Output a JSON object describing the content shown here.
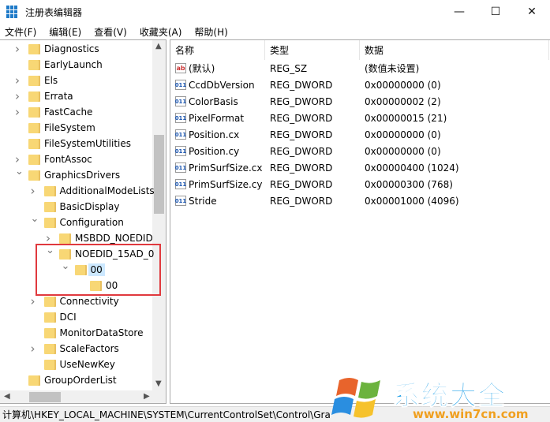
{
  "window": {
    "title": "注册表编辑器",
    "minimize": "—",
    "maximize": "☐",
    "close": "✕"
  },
  "menu": [
    "文件(F)",
    "编辑(E)",
    "查看(V)",
    "收藏夹(A)",
    "帮助(H)"
  ],
  "tree": [
    {
      "label": "Diagnostics",
      "level": 0,
      "expander": "collapsed"
    },
    {
      "label": "EarlyLaunch",
      "level": 0,
      "expander": "none"
    },
    {
      "label": "Els",
      "level": 0,
      "expander": "collapsed"
    },
    {
      "label": "Errata",
      "level": 0,
      "expander": "collapsed"
    },
    {
      "label": "FastCache",
      "level": 0,
      "expander": "collapsed"
    },
    {
      "label": "FileSystem",
      "level": 0,
      "expander": "none"
    },
    {
      "label": "FileSystemUtilities",
      "level": 0,
      "expander": "none"
    },
    {
      "label": "FontAssoc",
      "level": 0,
      "expander": "collapsed"
    },
    {
      "label": "GraphicsDrivers",
      "level": 0,
      "expander": "expanded"
    },
    {
      "label": "AdditionalModeLists",
      "level": 1,
      "expander": "collapsed"
    },
    {
      "label": "BasicDisplay",
      "level": 1,
      "expander": "none"
    },
    {
      "label": "Configuration",
      "level": 1,
      "expander": "expanded"
    },
    {
      "label": "MSBDD_NOEDID",
      "level": 2,
      "expander": "collapsed"
    },
    {
      "label": "NOEDID_15AD_0",
      "level": 2,
      "expander": "expanded"
    },
    {
      "label": "00",
      "level": 3,
      "expander": "expanded",
      "selected": true
    },
    {
      "label": "00",
      "level": 4,
      "expander": "none"
    },
    {
      "label": "Connectivity",
      "level": 1,
      "expander": "collapsed"
    },
    {
      "label": "DCI",
      "level": 1,
      "expander": "none"
    },
    {
      "label": "MonitorDataStore",
      "level": 1,
      "expander": "none"
    },
    {
      "label": "ScaleFactors",
      "level": 1,
      "expander": "collapsed"
    },
    {
      "label": "UseNewKey",
      "level": 1,
      "expander": "none"
    },
    {
      "label": "GroupOrderList",
      "level": 0,
      "expander": "none"
    }
  ],
  "columns": {
    "name": "名称",
    "type": "类型",
    "data": "数据"
  },
  "values": [
    {
      "icon": "string",
      "name": "(默认)",
      "type": "REG_SZ",
      "data": "(数值未设置)"
    },
    {
      "icon": "dword",
      "name": "CcdDbVersion",
      "type": "REG_DWORD",
      "data": "0x00000000 (0)"
    },
    {
      "icon": "dword",
      "name": "ColorBasis",
      "type": "REG_DWORD",
      "data": "0x00000002 (2)"
    },
    {
      "icon": "dword",
      "name": "PixelFormat",
      "type": "REG_DWORD",
      "data": "0x00000015 (21)"
    },
    {
      "icon": "dword",
      "name": "Position.cx",
      "type": "REG_DWORD",
      "data": "0x00000000 (0)"
    },
    {
      "icon": "dword",
      "name": "Position.cy",
      "type": "REG_DWORD",
      "data": "0x00000000 (0)"
    },
    {
      "icon": "dword",
      "name": "PrimSurfSize.cx",
      "type": "REG_DWORD",
      "data": "0x00000400 (1024)"
    },
    {
      "icon": "dword",
      "name": "PrimSurfSize.cy",
      "type": "REG_DWORD",
      "data": "0x00000300 (768)"
    },
    {
      "icon": "dword",
      "name": "Stride",
      "type": "REG_DWORD",
      "data": "0x00001000 (4096)"
    }
  ],
  "status": "计算机\\HKEY_LOCAL_MACHINE\\SYSTEM\\CurrentControlSet\\Control\\Gra",
  "watermark": {
    "text": "系统大全",
    "url": "www.win7cn.com"
  },
  "colors": {
    "highlight_box": "#e0393e",
    "selection": "#cce8ff",
    "folder": "#f8d775"
  }
}
